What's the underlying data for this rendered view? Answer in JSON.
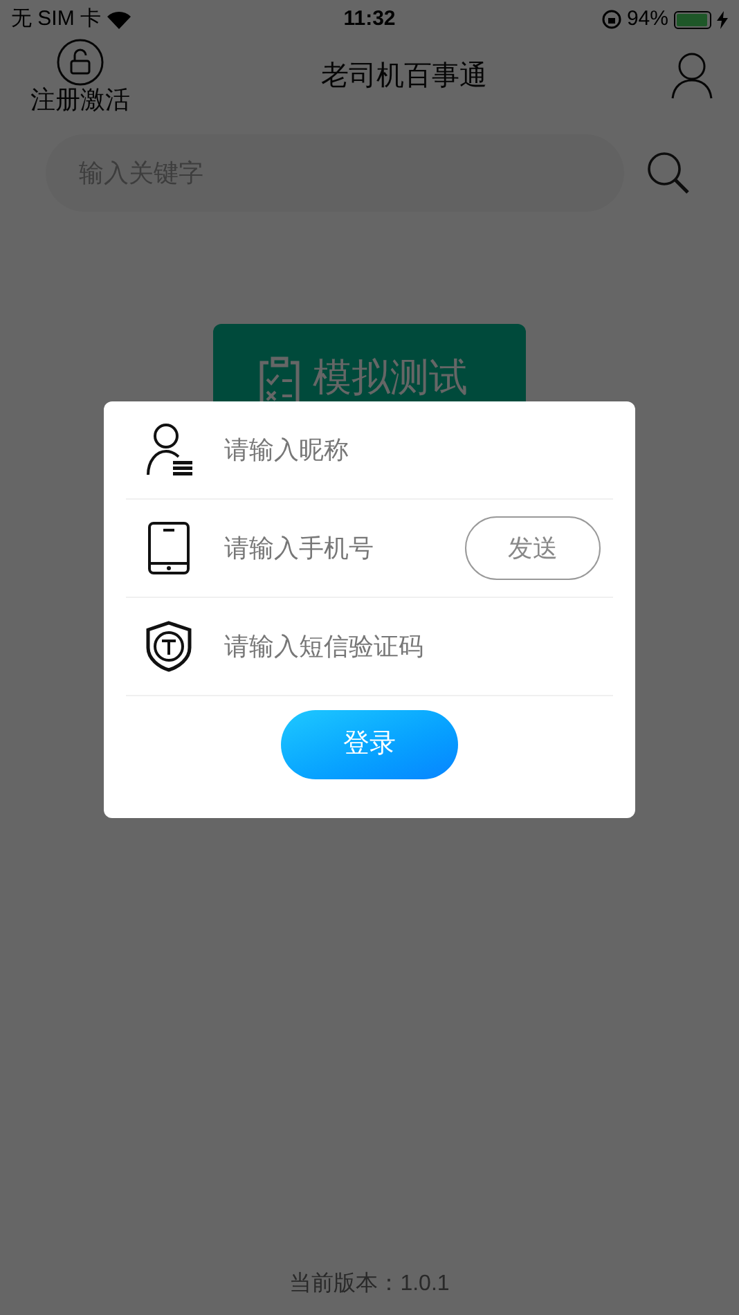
{
  "status_bar": {
    "carrier": "无 SIM 卡",
    "time": "11:32",
    "battery": "94%",
    "level": 0.94
  },
  "header": {
    "left_label": "注册激活",
    "title": "老司机百事通"
  },
  "search": {
    "placeholder": "输入关键字"
  },
  "test_button": {
    "label": "模拟测试"
  },
  "version": "当前版本：1.0.1",
  "dialog": {
    "fields": [
      {
        "kind": "nickname",
        "placeholder": "请输入昵称"
      },
      {
        "kind": "phone",
        "placeholder": "请输入手机号",
        "action": "发送"
      },
      {
        "kind": "code",
        "placeholder": "请输入短信验证码"
      }
    ],
    "submit": "登录"
  }
}
